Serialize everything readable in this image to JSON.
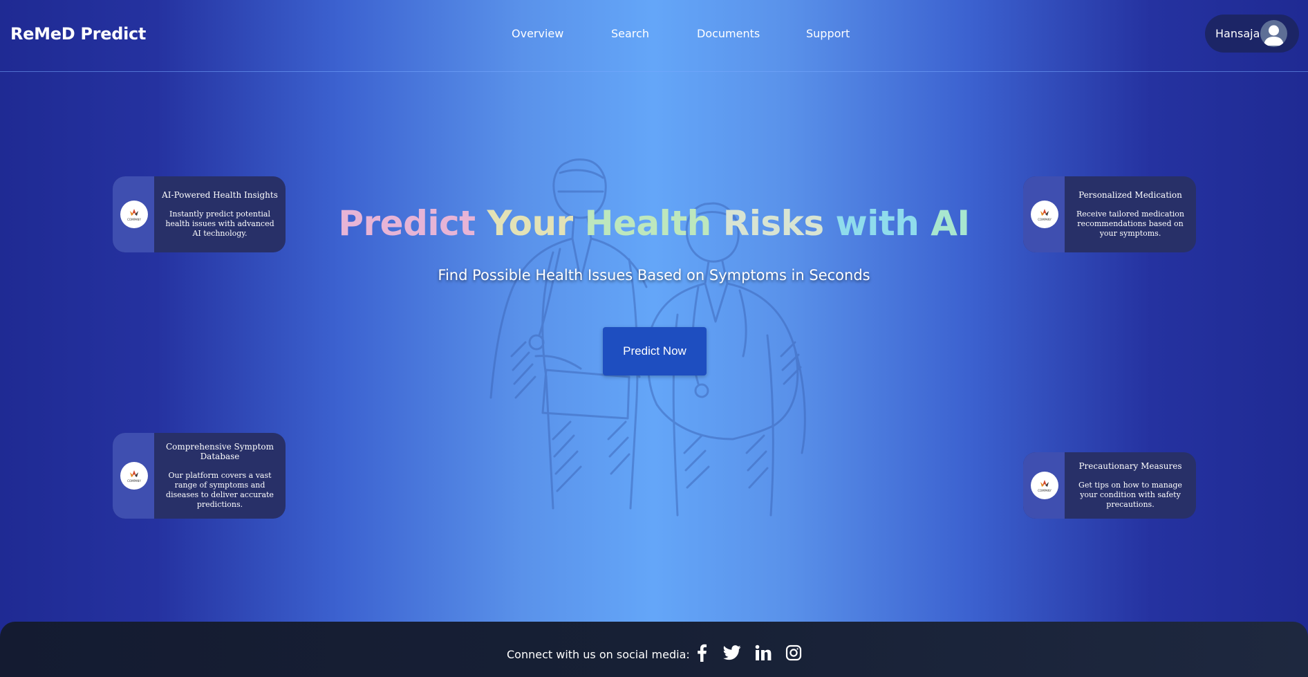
{
  "brand": {
    "name": "ReMeD Predict"
  },
  "nav": {
    "items": [
      {
        "label": "Overview"
      },
      {
        "label": "Search"
      },
      {
        "label": "Documents"
      },
      {
        "label": "Support"
      }
    ]
  },
  "user": {
    "name": "Hansaja",
    "icon": "user-avatar-icon"
  },
  "hero": {
    "title_words": [
      "Predict",
      "Your",
      "Health",
      "Risks",
      "with",
      "AI"
    ],
    "subtitle": "Find Possible Health Issues Based on Symptoms in Seconds",
    "cta_label": "Predict Now"
  },
  "features": [
    {
      "title": "AI-Powered Health Insights",
      "description": "Instantly predict potential health issues with advanced AI technology.",
      "logo_text": "COMPANY"
    },
    {
      "title": "Personalized Medication",
      "description": "Receive tailored medication recommendations based on your symptoms.",
      "logo_text": "COMPANY"
    },
    {
      "title": "Comprehensive Symptom Database",
      "description": "Our platform covers a vast range of symptoms and diseases to deliver accurate predictions.",
      "logo_text": "COMPANY"
    },
    {
      "title": "Precautionary Measures",
      "description": "Get tips on how to manage your condition with safety precautions.",
      "logo_text": "COMPANY"
    }
  ],
  "footer": {
    "text": "Connect with us on social media:",
    "social": [
      "facebook-icon",
      "twitter-icon",
      "linkedin-icon",
      "instagram-icon"
    ]
  },
  "colors": {
    "card_bg": "#283068",
    "card_side": "#3f4fb0",
    "cta_bg": "#1e4ec0",
    "footer_bg": "#141b31",
    "user_pill": "#1c2566"
  }
}
